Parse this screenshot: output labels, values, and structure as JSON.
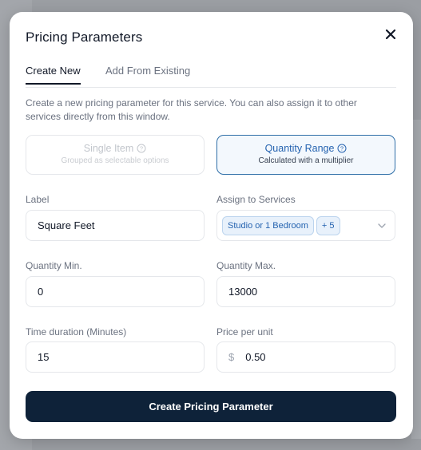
{
  "modal": {
    "title": "Pricing Parameters",
    "tabs": [
      {
        "label": "Create New",
        "active": true
      },
      {
        "label": "Add From Existing",
        "active": false
      }
    ],
    "description": "Create a new pricing parameter for this service. You can also assign it to other services directly from this window.",
    "types": [
      {
        "title": "Single Item",
        "subtitle": "Grouped as selectable options",
        "selected": false
      },
      {
        "title": "Quantity Range",
        "subtitle": "Calculated with a multiplier",
        "selected": true
      }
    ],
    "fields": {
      "label": {
        "label": "Label",
        "value": "Square Feet"
      },
      "assign": {
        "label": "Assign to Services",
        "chip": "Studio or 1 Bedroom",
        "more": "+ 5"
      },
      "qty_min": {
        "label": "Quantity Min.",
        "value": "0"
      },
      "qty_max": {
        "label": "Quantity Max.",
        "value": "13000"
      },
      "duration": {
        "label": "Time duration (Minutes)",
        "value": "15"
      },
      "price": {
        "label": "Price per unit",
        "currency": "$",
        "value": "0.50"
      }
    },
    "submit_label": "Create Pricing Parameter"
  },
  "colors": {
    "primary_button": "#0e2239",
    "accent": "#2563b0"
  }
}
